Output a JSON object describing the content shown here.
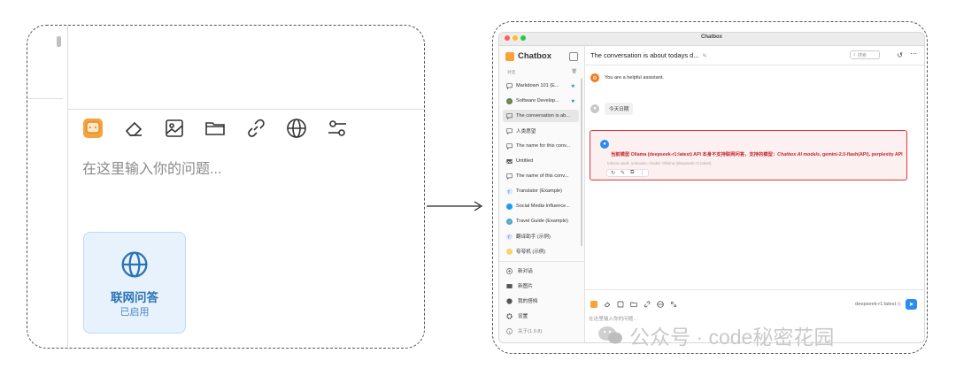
{
  "zoom": {
    "input_placeholder": "在这里输入你的问题...",
    "toolbar_icons": [
      "chatbox-logo-icon",
      "eraser-icon",
      "image-icon",
      "folder-icon",
      "link-icon",
      "globe-icon",
      "settings-sliders-icon"
    ],
    "web_search_card": {
      "title": "联网问答",
      "status": "已启用",
      "icon": "globe-icon"
    }
  },
  "app": {
    "window_title": "Chatbox",
    "brand": "Chatbox",
    "sidebar": {
      "section_label": "对话",
      "conversations": [
        {
          "label": "Markdown 101 (E...",
          "icon": "chat-icon",
          "starred": true
        },
        {
          "label": "Software Develop...",
          "icon": "agent-avatar-icon",
          "starred": true
        },
        {
          "label": "The conversation is ab...",
          "icon": "chat-icon",
          "active": true
        },
        {
          "label": "人类愿望",
          "icon": "chat-icon"
        },
        {
          "label": "The name for this conv...",
          "icon": "chat-icon"
        },
        {
          "label": "Untitled",
          "icon": "image-icon"
        },
        {
          "label": "The name of this conv...",
          "icon": "chat-icon"
        },
        {
          "label": "Translator (Example)",
          "icon": "translator-avatar-icon"
        },
        {
          "label": "Social Media Influence...",
          "icon": "twitter-avatar-icon"
        },
        {
          "label": "Travel Guide (Example)",
          "icon": "travel-avatar-icon"
        },
        {
          "label": "翻译助手 (示例)",
          "icon": "translator-avatar-icon"
        },
        {
          "label": "夸夸机 (示例)",
          "icon": "praise-avatar-icon"
        }
      ],
      "actions": [
        {
          "label": "新对话",
          "icon": "plus-circle-icon"
        },
        {
          "label": "新图片",
          "icon": "image-icon"
        },
        {
          "label": "我的搭档",
          "icon": "partners-icon"
        },
        {
          "label": "设置",
          "icon": "gear-icon"
        },
        {
          "label": "关于(1.9.8)",
          "icon": "info-icon"
        }
      ]
    },
    "header": {
      "title": "The conversation is about todays d...",
      "search_placeholder": "搜索"
    },
    "messages": [
      {
        "role": "system",
        "text": "You are a helpful assistant."
      },
      {
        "role": "user",
        "text": "今天日期"
      },
      {
        "role": "assistant",
        "text_a": "当前模型 Ollama (deepseek-r1:latest) API 本身不支持联网问答，支持的模型：",
        "text_b": "Chatbox AI models",
        "text_c": ", gemini-2.0-flash(API), perplexity API",
        "meta": "tokens used: unknown, model: Ollama (deepseek-r1:latest)"
      }
    ],
    "composer": {
      "placeholder": "在这里输入你的问题...",
      "model": "deepseek-r1:latest ◇"
    }
  },
  "watermark": {
    "text": "公众号 · code秘密花园"
  },
  "colors": {
    "accent": "#2a8cf1",
    "error_border": "#e0353c",
    "error_text": "#c3272d",
    "web_card_bg": "#e7f2fc"
  }
}
